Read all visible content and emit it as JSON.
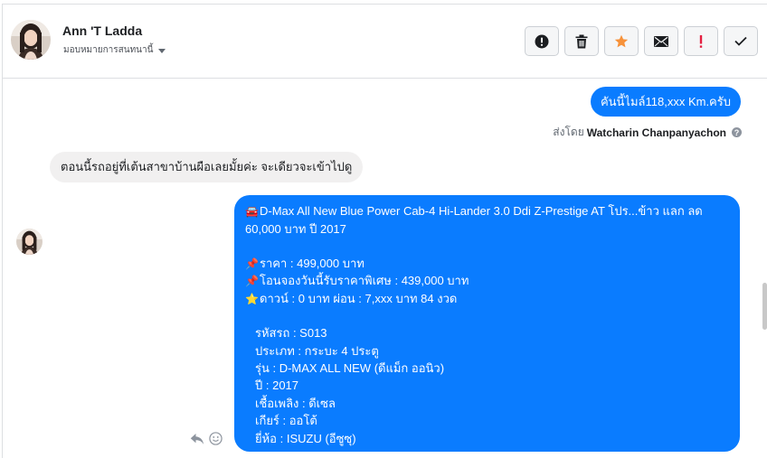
{
  "contact": {
    "name": "Ann 'T Ladda",
    "assign_label": "มอบหมายการสนทนานี้"
  },
  "actions": [
    {
      "name": "mark-spam-button",
      "icon": "alert-circle-icon"
    },
    {
      "name": "delete-button",
      "icon": "trash-icon"
    },
    {
      "name": "star-button",
      "icon": "star-icon"
    },
    {
      "name": "mark-unread-button",
      "icon": "envelope-icon"
    },
    {
      "name": "mark-important-button",
      "icon": "exclamation-icon"
    },
    {
      "name": "mark-done-button",
      "icon": "checkmark-icon"
    }
  ],
  "messages": {
    "outgoing_1": "คันนี้ไมล์118,xxx Km.ครับ",
    "sent_by_prefix": "ส่งโดย",
    "sent_by_name": "Watcharin Chanpanyachon",
    "incoming_1": "ตอนนี้รถอยู่ที่เต้นสาขาบ้านผือเลยมั้ยค่ะ จะเดียวจะเข้าไปดู",
    "outgoing_2": {
      "title": "D-Max All New Blue Power Cab-4 Hi-Lander 3.0 Ddi Z-Prestige AT โปร...ข้าว แลก ลด 60,000 บาท ปี 2017",
      "price": "ราคา : 499,000 บาท",
      "special": "โอนจองวันนี้รับราคาพิเศษ : 439,000 บาท",
      "down": "ดาวน์ : 0 บาท ผ่อน : 7,xxx บาท 84 งวด",
      "code": "รหัสรถ : S013",
      "category": "ประเภท : กระบะ 4 ประตู",
      "model": "รุ่น : D-MAX ALL NEW (ดีแม็ก ออนิว)",
      "year": "ปี : 2017",
      "fuel": "เชื้อเพลิง : ดีเซล",
      "gear": "เกียร์ : ออโต้",
      "brand": "ยี่ห้อ : ISUZU (อีซูซุ)"
    }
  },
  "icons": {
    "car": "🚘",
    "pin": "📌",
    "star": "⭐"
  },
  "colors": {
    "outgoing_bubble": "#0a7cff",
    "incoming_bubble": "#f1f0f0",
    "star_orange": "#f7923a",
    "important_red": "#e41e3f"
  }
}
